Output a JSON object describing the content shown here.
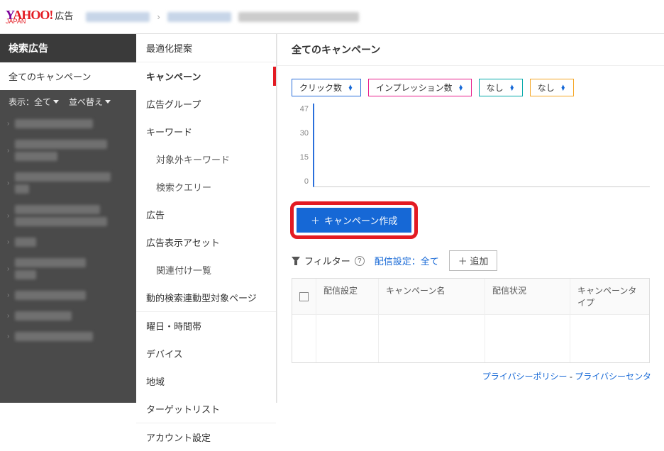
{
  "header": {
    "logo_main": "YAHOO!",
    "logo_sub": "JAPAN",
    "logo_ad": "広告"
  },
  "left": {
    "title": "検索広告",
    "all_label": "全てのキャンペーン",
    "disp": "表示：全て",
    "sort": "並べ替え"
  },
  "mid": {
    "items": [
      {
        "label": "最適化提案"
      },
      {
        "label": "キャンペーン",
        "active": true,
        "sep": true
      },
      {
        "label": "広告グループ"
      },
      {
        "label": "キーワード"
      },
      {
        "label": "対象外キーワード",
        "sub": true
      },
      {
        "label": "検索クエリー",
        "sub": true
      },
      {
        "label": "広告"
      },
      {
        "label": "広告表示アセット"
      },
      {
        "label": "関連付け一覧",
        "sub": true
      },
      {
        "label": "動的検索連動型対象ページ"
      },
      {
        "label": "曜日・時間帯",
        "sep": true
      },
      {
        "label": "デバイス"
      },
      {
        "label": "地域"
      },
      {
        "label": "ターゲットリスト"
      },
      {
        "label": "アカウント設定",
        "sep": true
      }
    ]
  },
  "main": {
    "title": "全てのキャンペーン",
    "metrics": [
      {
        "label": "クリック数",
        "cls": "blue"
      },
      {
        "label": "インプレッション数",
        "cls": "pink"
      },
      {
        "label": "なし",
        "cls": "teal"
      },
      {
        "label": "なし",
        "cls": "orange"
      }
    ],
    "cta": "キャンペーン作成",
    "filter_label": "フィルター",
    "dist_label": "配信設定：全て",
    "add_label": "追加",
    "cols": {
      "c1": "配信設定",
      "c2": "キャンペーン名",
      "c3": "配信状況",
      "c4": "キャンペーンタイプ"
    },
    "footer": {
      "a": "プライバシーポリシー",
      "b": "プライバシーセンタ"
    }
  },
  "chart_data": {
    "type": "line",
    "title": "",
    "xlabel": "",
    "ylabel": "",
    "ylim": [
      0,
      47
    ],
    "yticks": [
      0,
      15,
      30,
      47
    ],
    "series": [
      {
        "name": "クリック数",
        "values": []
      }
    ],
    "categories": []
  }
}
